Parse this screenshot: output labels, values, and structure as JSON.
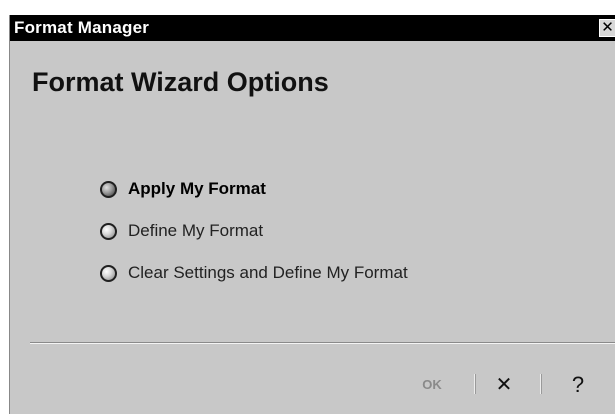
{
  "window": {
    "title": "Format Manager",
    "close_glyph": "✕",
    "close_icon": "close-icon"
  },
  "main": {
    "heading": "Format Wizard Options",
    "options": [
      {
        "label": "Apply My Format",
        "selected": true
      },
      {
        "label": "Define My Format",
        "selected": false
      },
      {
        "label": "Clear Settings and Define My Format",
        "selected": false
      }
    ]
  },
  "footer": {
    "ok_label": "OK",
    "cancel_label": "✕",
    "help_label": "?",
    "ok_enabled": false
  },
  "colors": {
    "titlebar_bg": "#000000",
    "dialog_bg": "#c8c8c8",
    "disabled_text": "#8a8a8a"
  }
}
